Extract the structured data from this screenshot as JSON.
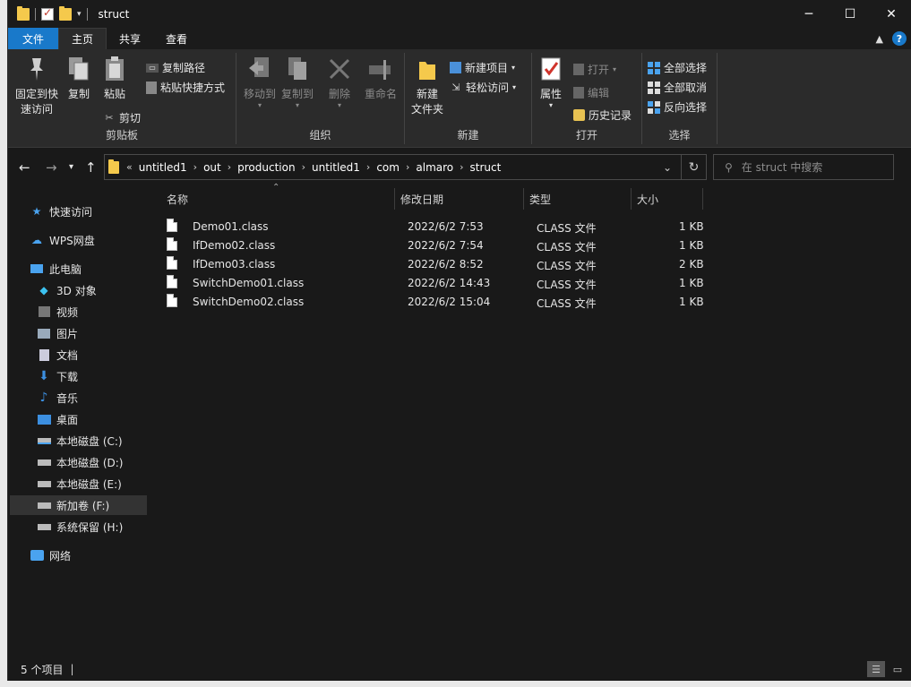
{
  "window": {
    "title": "struct"
  },
  "tabs": [
    {
      "label": "文件"
    },
    {
      "label": "主页"
    },
    {
      "label": "共享"
    },
    {
      "label": "查看"
    }
  ],
  "ribbon": {
    "clipboard": {
      "label": "剪贴板",
      "pin_line1": "固定到快",
      "pin_line2": "速访问",
      "copy": "复制",
      "paste": "粘贴",
      "copy_path": "复制路径",
      "paste_shortcut": "粘贴快捷方式",
      "cut": "剪切"
    },
    "organize": {
      "label": "组织",
      "move_to": "移动到",
      "copy_to": "复制到",
      "delete": "删除",
      "rename": "重命名"
    },
    "new": {
      "label": "新建",
      "new_folder_line1": "新建",
      "new_folder_line2": "文件夹",
      "new_item": "新建项目",
      "easy_access": "轻松访问"
    },
    "open": {
      "label": "打开",
      "properties": "属性",
      "open": "打开",
      "edit": "编辑",
      "history": "历史记录"
    },
    "select": {
      "label": "选择",
      "select_all": "全部选择",
      "select_none": "全部取消",
      "invert": "反向选择"
    }
  },
  "address": {
    "overflow": "«",
    "crumbs": [
      "untitled1",
      "out",
      "production",
      "untitled1",
      "com",
      "almaro",
      "struct"
    ]
  },
  "search": {
    "placeholder": "在 struct 中搜索"
  },
  "nav": [
    {
      "label": "快速访问",
      "icon": "star-icon"
    },
    {
      "label": "WPS网盘",
      "icon": "cloud-icon"
    },
    {
      "label": "此电脑",
      "icon": "computer-icon"
    },
    {
      "label": "3D 对象",
      "icon": "cube-icon"
    },
    {
      "label": "视频",
      "icon": "video-icon"
    },
    {
      "label": "图片",
      "icon": "picture-icon"
    },
    {
      "label": "文档",
      "icon": "document-icon"
    },
    {
      "label": "下载",
      "icon": "download-icon"
    },
    {
      "label": "音乐",
      "icon": "music-icon"
    },
    {
      "label": "桌面",
      "icon": "desktop-icon"
    },
    {
      "label": "本地磁盘 (C:)",
      "icon": "drive-icon"
    },
    {
      "label": "本地磁盘 (D:)",
      "icon": "drive-icon"
    },
    {
      "label": "本地磁盘 (E:)",
      "icon": "drive-icon"
    },
    {
      "label": "新加卷 (F:)",
      "icon": "drive-icon"
    },
    {
      "label": "系统保留 (H:)",
      "icon": "drive-icon"
    },
    {
      "label": "网络",
      "icon": "network-icon"
    }
  ],
  "columns": {
    "name": "名称",
    "date": "修改日期",
    "type": "类型",
    "size": "大小"
  },
  "files": [
    {
      "name": "Demo01.class",
      "date": "2022/6/2 7:53",
      "type": "CLASS 文件",
      "size": "1 KB"
    },
    {
      "name": "IfDemo02.class",
      "date": "2022/6/2 7:54",
      "type": "CLASS 文件",
      "size": "1 KB"
    },
    {
      "name": "IfDemo03.class",
      "date": "2022/6/2 8:52",
      "type": "CLASS 文件",
      "size": "2 KB"
    },
    {
      "name": "SwitchDemo01.class",
      "date": "2022/6/2 14:43",
      "type": "CLASS 文件",
      "size": "1 KB"
    },
    {
      "name": "SwitchDemo02.class",
      "date": "2022/6/2 15:04",
      "type": "CLASS 文件",
      "size": "1 KB"
    }
  ],
  "status": {
    "count": "5 个项目"
  },
  "colors": {
    "accent": "#1979ca",
    "folder": "#f5c94c",
    "background": "#191919",
    "ribbon": "#2b2b2b"
  }
}
